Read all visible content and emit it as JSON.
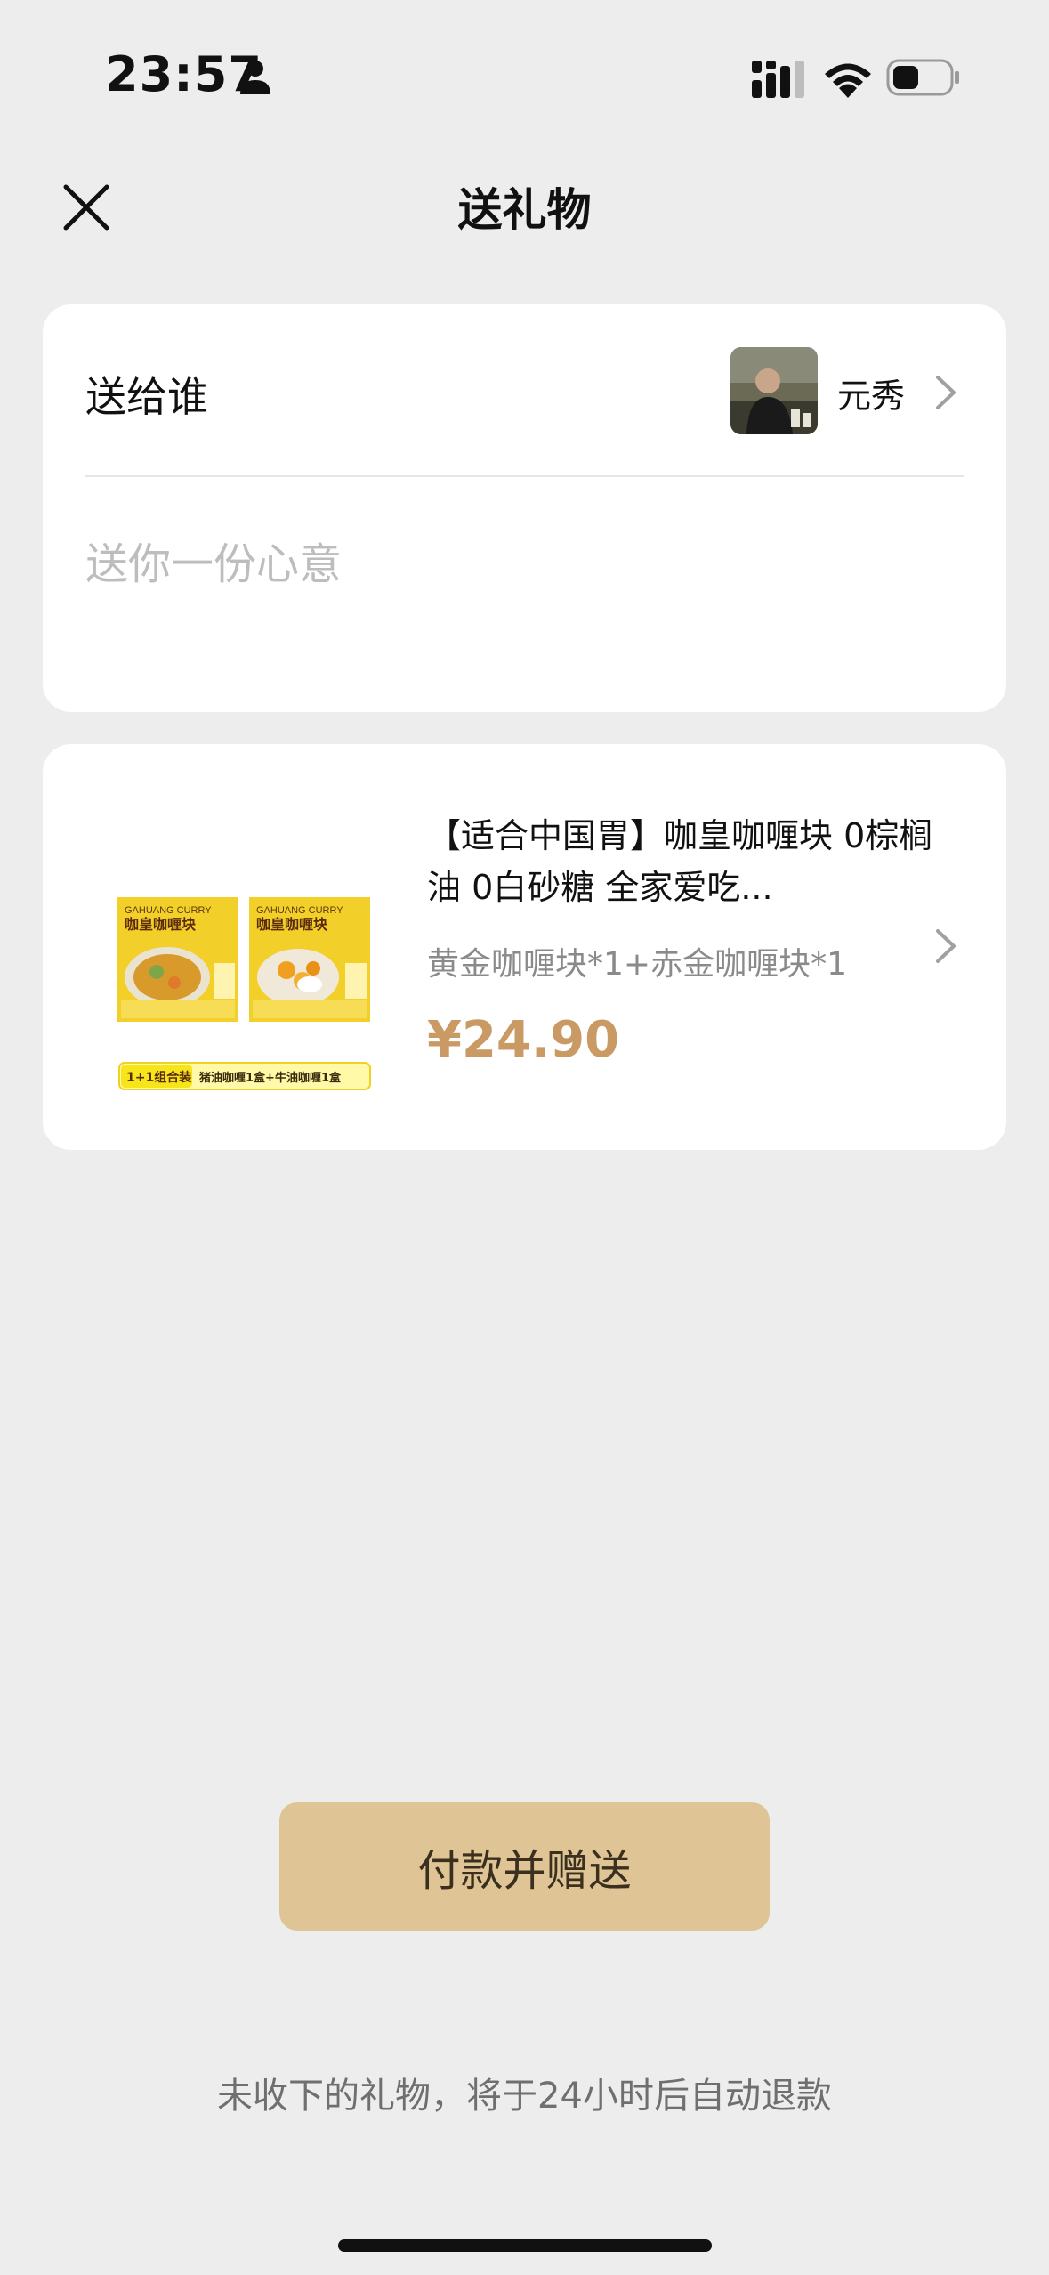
{
  "status_bar": {
    "time": "23:57"
  },
  "nav": {
    "title": "送礼物",
    "close_icon": "close-icon"
  },
  "recipient": {
    "label": "送给谁",
    "name": "元秀",
    "message_placeholder": "送你一份心意",
    "message_value": ""
  },
  "product": {
    "title": "【适合中国胃】咖皇咖喱块 0棕榈油 0白砂糖 全家爱吃...",
    "spec": "黄金咖喱块*1+赤金咖喱块*1",
    "price": "¥24.90",
    "image": {
      "box1_brand": "GAHUANG CURRY",
      "box1_name": "咖皇咖喱块",
      "box2_brand": "GAHUANG CURRY",
      "box2_name": "咖皇咖喱块",
      "banner_tag": "1+1组合装",
      "banner_text": "猪油咖喱1盒+牛油咖喱1盒"
    }
  },
  "actions": {
    "pay_label": "付款并赠送"
  },
  "footer": {
    "note": "未收下的礼物，将于24小时后自动退款"
  },
  "colors": {
    "background": "#ededed",
    "price": "#c99a64",
    "pay_button": "#dfc596"
  }
}
